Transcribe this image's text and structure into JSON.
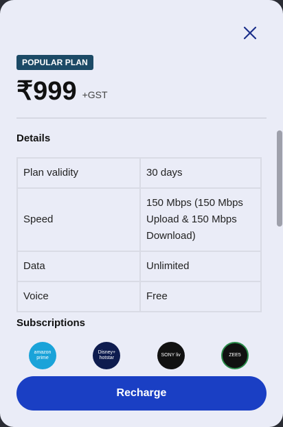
{
  "plan": {
    "badge": "POPULAR PLAN",
    "price": "₹999",
    "tax_note": "+GST"
  },
  "details": {
    "title": "Details",
    "rows": [
      {
        "key": "Plan validity",
        "value": "30 days"
      },
      {
        "key": "Speed",
        "value": "150 Mbps (150 Mbps Upload & 150 Mbps Download)"
      },
      {
        "key": "Data",
        "value": "Unlimited"
      },
      {
        "key": "Voice",
        "value": "Free"
      }
    ]
  },
  "subscriptions": {
    "title": "Subscriptions",
    "logos": [
      {
        "name": "amazon-prime",
        "text": "amazon prime"
      },
      {
        "name": "disney-hotstar",
        "text": "Disney+ hotstar"
      },
      {
        "name": "sony-liv",
        "text": "SONY liv"
      },
      {
        "name": "zee5",
        "text": "ZEE5"
      }
    ]
  },
  "actions": {
    "recharge_label": "Recharge",
    "close_icon": "close-icon"
  },
  "colors": {
    "badge_bg": "#1c4a66",
    "button_bg": "#1a3fc4",
    "sheet_bg": "#eaecf7"
  }
}
